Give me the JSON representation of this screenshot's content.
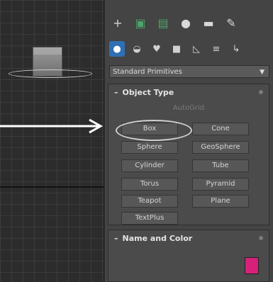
{
  "toolbar": {
    "tabs": [
      "create-icon",
      "modify-icon",
      "hierarchy-icon",
      "motion-icon",
      "display-icon",
      "utilities-icon"
    ],
    "subcategories": [
      "geometry-icon",
      "shapes-icon",
      "lights-icon",
      "cameras-icon",
      "helpers-icon",
      "spacewarps-icon",
      "systems-icon"
    ]
  },
  "dropdown": {
    "value": "Standard Primitives"
  },
  "object_type": {
    "title": "Object Type",
    "autogrid": "AutoGrid",
    "buttons": [
      "Box",
      "Cone",
      "Sphere",
      "GeoSphere",
      "Cylinder",
      "Tube",
      "Torus",
      "Pyramid",
      "Teapot",
      "Plane",
      "TextPlus"
    ]
  },
  "name_color": {
    "title": "Name and Color",
    "swatch_color": "#d8207a"
  }
}
